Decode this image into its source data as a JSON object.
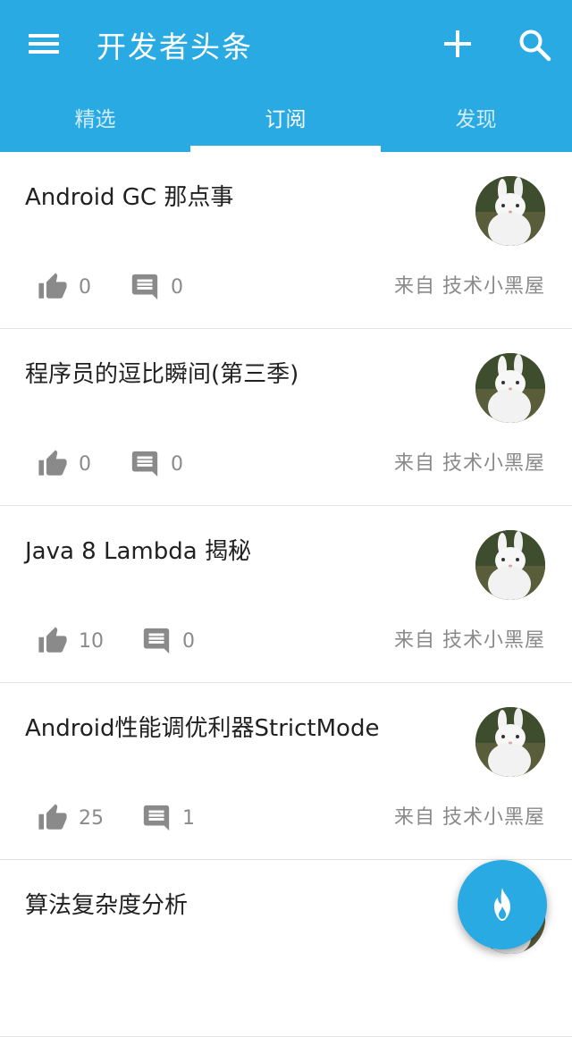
{
  "app_bar": {
    "title": "开发者头条",
    "menu_icon": "hamburger-menu-icon",
    "add_icon": "plus-icon",
    "search_icon": "search-icon",
    "color": "#29aae3"
  },
  "tabs": [
    {
      "label": "精选",
      "active": false
    },
    {
      "label": "订阅",
      "active": true
    },
    {
      "label": "发现",
      "active": false
    }
  ],
  "feed": [
    {
      "title": "Android GC 那点事",
      "likes": "0",
      "comments": "0",
      "source": "来自 技术小黑屋"
    },
    {
      "title": "程序员的逗比瞬间(第三季)",
      "likes": "0",
      "comments": "0",
      "source": "来自 技术小黑屋"
    },
    {
      "title": "Java 8 Lambda 揭秘",
      "likes": "10",
      "comments": "0",
      "source": "来自 技术小黑屋"
    },
    {
      "title": "Android性能调优利器StrictMode",
      "likes": "25",
      "comments": "1",
      "source": "来自 技术小黑屋"
    },
    {
      "title": "算法复杂度分析",
      "likes": "",
      "comments": "",
      "source": ""
    }
  ],
  "fab": {
    "icon": "flame-icon"
  }
}
